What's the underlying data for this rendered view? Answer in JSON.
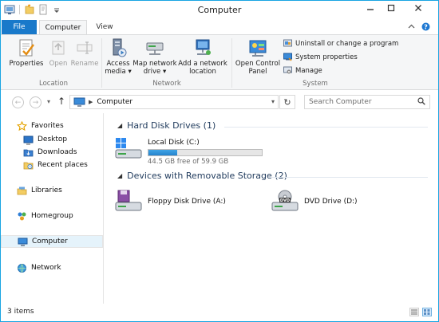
{
  "window": {
    "title": "Computer",
    "accent": "#1979ca",
    "controls": [
      "minimize-icon",
      "maximize-icon",
      "close-icon"
    ]
  },
  "qat": [
    "properties-icon",
    "new-folder-icon",
    "customize-dropdown-icon"
  ],
  "tabs": {
    "file": "File",
    "computer": "Computer",
    "view": "View"
  },
  "ribbon": {
    "location": {
      "label": "Location",
      "properties": "Properties",
      "open": "Open",
      "rename": "Rename"
    },
    "network": {
      "label": "Network",
      "access_media_1": "Access",
      "access_media_2": "media ▾",
      "map_drive_1": "Map network",
      "map_drive_2": "drive ▾",
      "add_location_1": "Add a network",
      "add_location_2": "location"
    },
    "system": {
      "label": "System",
      "control_panel_1": "Open Control",
      "control_panel_2": "Panel",
      "uninstall": "Uninstall or change a program",
      "system_properties": "System properties",
      "manage": "Manage"
    }
  },
  "address": {
    "crumb": "Computer",
    "search_placeholder": "Search Computer"
  },
  "nav_pane": {
    "favorites": "Favorites",
    "desktop": "Desktop",
    "downloads": "Downloads",
    "recent": "Recent places",
    "libraries": "Libraries",
    "homegroup": "Homegroup",
    "computer": "Computer",
    "network": "Network"
  },
  "content": {
    "hard_disks_header": "Hard Disk Drives (1)",
    "removable_header": "Devices with Removable Storage (2)",
    "local_disk": {
      "name": "Local Disk (C:)",
      "free": "44.5 GB free of 59.9 GB",
      "used_fraction": 0.257
    },
    "floppy": "Floppy Disk Drive (A:)",
    "dvd": "DVD Drive (D:)",
    "dvd_badge": "DVD"
  },
  "status": {
    "count": "3 items"
  }
}
